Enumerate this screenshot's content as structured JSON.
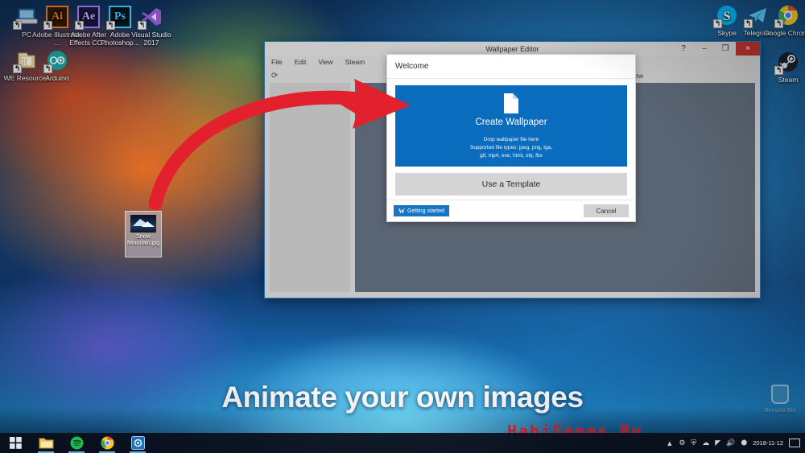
{
  "desktop": {
    "icons": [
      {
        "name": "pc",
        "label": "PC",
        "glyph": "monitor-icon"
      },
      {
        "name": "adobe-illustrator",
        "label": "Adobe Illustrator ...",
        "glyph": "Ai",
        "color": "#ff7f18",
        "bg": "#2b1a05"
      },
      {
        "name": "adobe-after-effects",
        "label": "Adobe After Effects CC...",
        "glyph": "Ae",
        "color": "#9b8bff",
        "bg": "#1f1340"
      },
      {
        "name": "adobe-photoshop",
        "label": "Adobe Photoshop...",
        "glyph": "Ps",
        "color": "#3ad3ff",
        "bg": "#031420"
      },
      {
        "name": "visual-studio",
        "label": "Visual Studio 2017",
        "glyph": "visual-studio-icon",
        "color": "#9b5bd6"
      },
      {
        "name": "we-resources",
        "label": "WE Resources",
        "glyph": "folder-icon"
      },
      {
        "name": "arduino",
        "label": "Arduino",
        "glyph": "arduino-icon",
        "color": "#1aa3a3"
      },
      {
        "name": "skype",
        "label": "Skype",
        "glyph": "S",
        "color": "#00aff0"
      },
      {
        "name": "telegram",
        "label": "Telegram",
        "glyph": "telegram-icon",
        "color": "#2aabee"
      },
      {
        "name": "google-chrome",
        "label": "Google Chrome",
        "glyph": "chrome-icon"
      },
      {
        "name": "steam",
        "label": "Steam",
        "glyph": "steam-icon"
      }
    ],
    "selected_file": {
      "label": "Snow Mountain.jpg"
    },
    "recycle_bin_label": "Recycle Bin",
    "headline": "Animate your own images",
    "watermark": "HabiGames.Ru"
  },
  "editor": {
    "title": "Wallpaper Editor",
    "menu": [
      "File",
      "Edit",
      "View",
      "Steam"
    ],
    "toolbar": {
      "refresh_icon": "refresh-icon",
      "preview_label": "Preview"
    },
    "window_controls": {
      "help": "?",
      "minimize": "–",
      "maximize": "❐",
      "close": "×"
    }
  },
  "welcome": {
    "header": "Welcome",
    "create": {
      "title": "Create Wallpaper",
      "drop_hint": "Drop wallpaper file here",
      "supported_line1": "Supported file types:  jpeg,  png,  tga,",
      "supported_line2": "gif,  mp4,  exe,  html,  obj,  fbx"
    },
    "template_button": "Use a Template",
    "getting_started": {
      "badge": "W",
      "label": "Getting started"
    },
    "cancel_button": "Cancel"
  },
  "taskbar": {
    "items": [
      {
        "name": "start-button",
        "glyph": "windows-icon"
      },
      {
        "name": "file-explorer",
        "glyph": "folder-icon"
      },
      {
        "name": "spotify",
        "glyph": "spotify-icon"
      },
      {
        "name": "chrome",
        "glyph": "chrome-icon"
      },
      {
        "name": "wallpaper-engine",
        "glyph": "wallpaper-engine-icon"
      }
    ],
    "tray": {
      "icons": [
        "chevron-up-icon",
        "wallpaper-engine-tray-icon",
        "shield-icon",
        "cloud-icon",
        "network-icon",
        "volume-icon",
        "bluetooth-icon"
      ],
      "date": "2018-11-12",
      "notification_icon": "notification-icon"
    }
  },
  "colors": {
    "accent_blue": "#0a6cbd",
    "arrow_red": "#e3202e",
    "window_gray": "#c6c6c6",
    "close_red": "#b3312c"
  }
}
